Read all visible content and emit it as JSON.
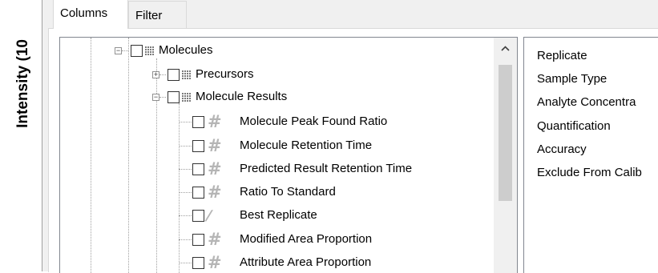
{
  "background_axis": {
    "label": "Intensity (10"
  },
  "tabs": [
    {
      "label": "Columns",
      "selected": true
    },
    {
      "label": "Filter",
      "selected": false
    }
  ],
  "tree": {
    "molecules": {
      "label": "Molecules",
      "expanded": true,
      "checked": false
    },
    "precursors": {
      "label": "Precursors",
      "expanded": false,
      "checked": false
    },
    "molecule_results": {
      "label": "Molecule Results",
      "expanded": true,
      "checked": false
    },
    "fields": [
      {
        "label": "Molecule Peak Found Ratio",
        "icon": "hash-icon"
      },
      {
        "label": "Molecule Retention Time",
        "icon": "hash-icon"
      },
      {
        "label": "Predicted Result Retention Time",
        "icon": "hash-icon"
      },
      {
        "label": "Ratio To Standard",
        "icon": "hash-icon"
      },
      {
        "label": "Best Replicate",
        "icon": "boolean-icon"
      },
      {
        "label": "Modified Area Proportion",
        "icon": "hash-icon"
      },
      {
        "label": "Attribute Area Proportion",
        "icon": "hash-icon"
      }
    ]
  },
  "selected_columns": [
    "Replicate",
    "Sample Type",
    "Analyte Concentra",
    "Quantification",
    "Accuracy",
    "Exclude From Calib"
  ],
  "colors": {
    "dialog_bg": "#f0f0f0",
    "list_border": "#828790",
    "scroll_thumb": "#cdcdcd",
    "tree_lines": "#a0a0a0"
  }
}
